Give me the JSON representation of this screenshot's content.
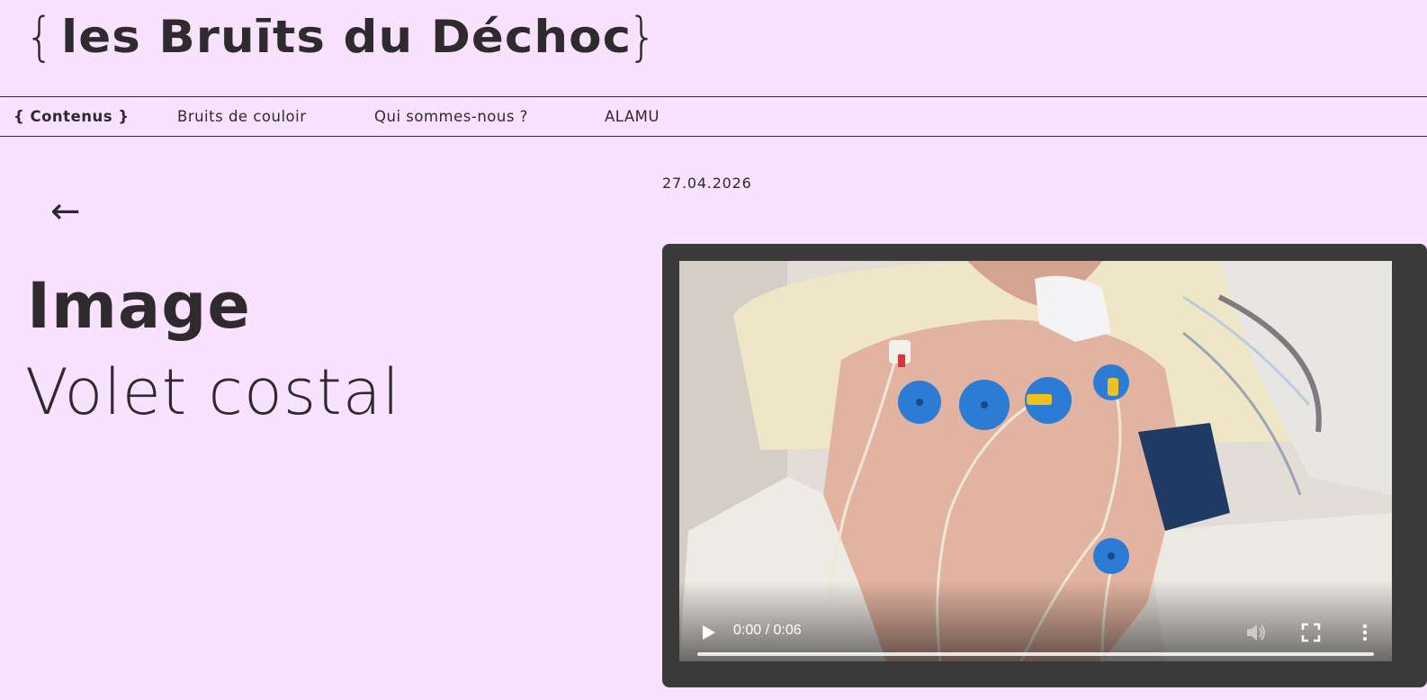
{
  "site": {
    "brace_open": "{",
    "title": "les Bruīts du Déchoc",
    "brace_close": "}"
  },
  "nav": {
    "items": [
      {
        "label": "{ Contenus }",
        "active": true
      },
      {
        "label": "Bruits de couloir",
        "active": false
      },
      {
        "label": "Qui sommes-nous ?",
        "active": false
      },
      {
        "label": "ALAMU",
        "active": false
      }
    ]
  },
  "post": {
    "back_icon": "arrow-left-icon",
    "back_glyph": "←",
    "category": "Image",
    "title": "Volet costal",
    "date": "27.04.2026"
  },
  "video": {
    "time_display": "0:00 / 0:06",
    "progress_fraction": 0,
    "icons": {
      "play": "play-icon",
      "volume": "volume-icon",
      "fullscreen": "fullscreen-icon",
      "more": "more-vertical-icon"
    }
  },
  "colors": {
    "background": "#f8e2ff",
    "text": "#2e2a2e",
    "player_frame": "#3a3a3a",
    "electrode_blue": "#2c7bd4",
    "cuff_navy": "#1f3a63"
  }
}
